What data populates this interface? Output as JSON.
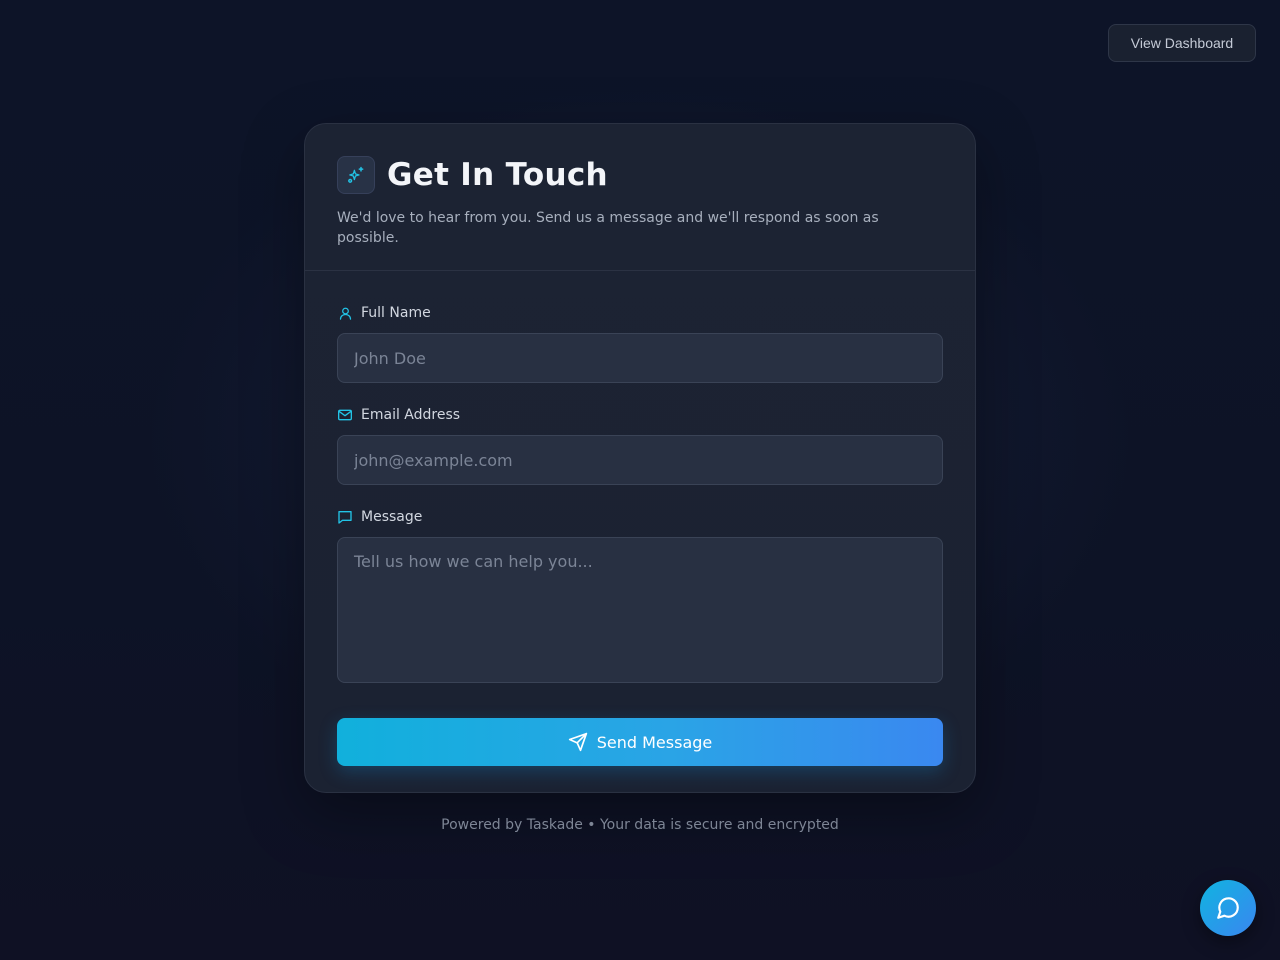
{
  "header": {
    "dashboard_button_label": "View Dashboard"
  },
  "card": {
    "logo_icon": "sparkles-icon",
    "title": "Get In Touch",
    "subtitle": "We'd love to hear from you. Send us a message and we'll respond as soon as possible."
  },
  "form": {
    "name": {
      "icon": "user-icon",
      "label": "Full Name",
      "placeholder": "John Doe",
      "value": ""
    },
    "email": {
      "icon": "mail-icon",
      "label": "Email Address",
      "placeholder": "john@example.com",
      "value": ""
    },
    "message": {
      "icon": "message-square-icon",
      "label": "Message",
      "placeholder": "Tell us how we can help you...",
      "value": ""
    },
    "submit": {
      "icon": "send-icon",
      "label": "Send Message"
    }
  },
  "footer": {
    "text": "Powered by Taskade • Your data is secure and encrypted"
  },
  "chat_widget": {
    "icon": "message-circle-icon"
  },
  "colors": {
    "background": "#0e1426",
    "card": "#1c2333",
    "accent": "#22c3e6",
    "button_gradient_start": "#11b0dc",
    "button_gradient_end": "#3a88f0"
  }
}
